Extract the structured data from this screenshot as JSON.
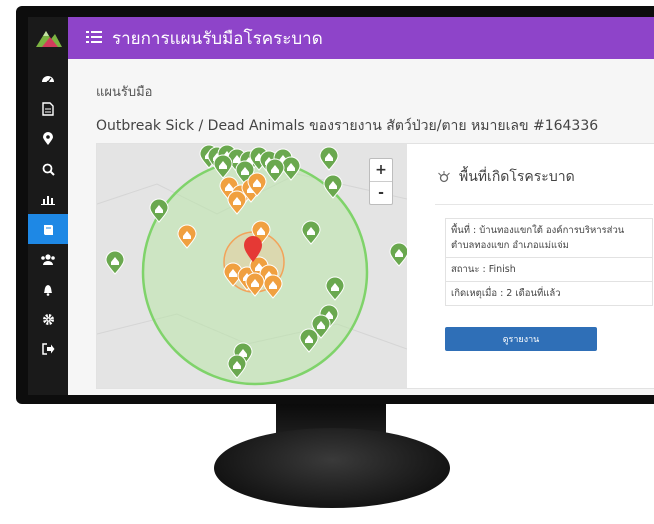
{
  "app": {
    "title": "รายการแผนรับมือโรคระบาด",
    "menu_icon": "list-icon",
    "accent_color": "#8e44c9",
    "sidebar_color": "#1a1a1a",
    "active_nav_color": "#1e88e5"
  },
  "sidebar": {
    "logo_icon": "mountain-logo",
    "items": [
      {
        "icon": "dashboard-icon",
        "active": false
      },
      {
        "icon": "document-icon",
        "active": false
      },
      {
        "icon": "map-marker-icon",
        "active": false
      },
      {
        "icon": "search-icon",
        "active": false
      },
      {
        "icon": "bar-chart-icon",
        "active": false
      },
      {
        "icon": "book-icon",
        "active": true
      },
      {
        "icon": "users-icon",
        "active": false
      },
      {
        "icon": "bell-icon",
        "active": false
      },
      {
        "icon": "gear-icon",
        "active": false
      },
      {
        "icon": "sign-out-icon",
        "active": false
      }
    ]
  },
  "page": {
    "breadcrumb": "แผนรับมือ",
    "subtitle": "Outbreak Sick / Dead Animals ของรายงาน สัตว์ป่วย/ตาย หมายเลข #164336"
  },
  "map": {
    "zoom_in": "+",
    "zoom_out": "-",
    "green_marker_color": "#6aa84f",
    "orange_marker_color": "#f0a040",
    "red_marker_color": "#e53935"
  },
  "panel": {
    "icon": "virus-icon",
    "title": "พื้นที่เกิดโรคระบาด",
    "rows": [
      "พื้นที่ : บ้านทองแขกใต้ องค์การบริหารส่วนตำบลทองแขก อำเภอแม่แจ่ม",
      "สถานะ : Finish",
      "เกิดเหตุเมื่อ : 2 เดือนที่แล้ว"
    ],
    "report_button": "ดูรายงาน",
    "report_button_color": "#2f6fb7"
  }
}
